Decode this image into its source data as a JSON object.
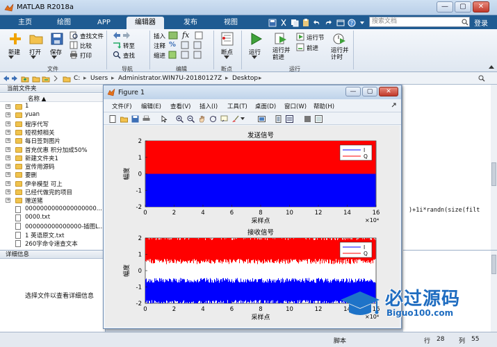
{
  "app": {
    "title": "MATLAB R2018a",
    "min": "—",
    "max": "▢",
    "close": "✕"
  },
  "tabs": [
    {
      "label": "主页"
    },
    {
      "label": "绘图"
    },
    {
      "label": "APP"
    },
    {
      "label": "编辑器"
    },
    {
      "label": "发布"
    },
    {
      "label": "视图"
    }
  ],
  "search": {
    "placeholder": "搜索文档"
  },
  "login": "登录",
  "ribbon": {
    "new": "新建",
    "open": "打开",
    "save": "保存",
    "find_files": "查找文件",
    "compare": "比较",
    "print": "打印",
    "goto": "转至",
    "find": "查找",
    "insert": "插入",
    "comment": "注释",
    "indent": "缩进",
    "breakpoint": "断点",
    "run": "运行",
    "run_advance": "运行并\n前进",
    "run_section": "运行节",
    "advance": "前进",
    "run_time": "运行并\n计时",
    "groups": {
      "file": "文件",
      "nav": "导航",
      "edit": "编辑",
      "breakpoints": "断点",
      "run": "运行"
    }
  },
  "address": {
    "path": [
      "C:",
      "Users",
      "Administrator.WIN7U-20180127Z",
      "Desktop"
    ]
  },
  "current_folder": {
    "title": "当前文件夹",
    "col_name": "名称 ▲",
    "items": [
      {
        "name": "1",
        "type": "folder"
      },
      {
        "name": "yuan",
        "type": "folder"
      },
      {
        "name": "程序代写",
        "type": "folder"
      },
      {
        "name": "短视频相关",
        "type": "folder"
      },
      {
        "name": "每日签到图片",
        "type": "folder"
      },
      {
        "name": "首充优惠 积分加成50%",
        "type": "folder"
      },
      {
        "name": "新建文件夹1",
        "type": "folder"
      },
      {
        "name": "宣传用源码",
        "type": "folder"
      },
      {
        "name": "要删",
        "type": "folder"
      },
      {
        "name": "伊辛模型 可上",
        "type": "folder"
      },
      {
        "name": "已经代做完的项目",
        "type": "folder"
      },
      {
        "name": "赠送猪",
        "type": "folder"
      },
      {
        "name": "0000000000000000000...",
        "type": "file"
      },
      {
        "name": "0000.txt",
        "type": "file"
      },
      {
        "name": "000000000000000-插图L...",
        "type": "file"
      },
      {
        "name": "1 英语原文.txt",
        "type": "file"
      },
      {
        "name": "260字命令速查文本",
        "type": "file"
      }
    ]
  },
  "details": {
    "title": "详细信息",
    "hint": "选择文件以查看详细信息"
  },
  "editor": {
    "code_fragment": ")+1i*randn(size(filt"
  },
  "status": {
    "script": "脚本",
    "row_label": "行",
    "row": "28",
    "col_label": "列",
    "col": "55"
  },
  "figure": {
    "title": "Figure 1",
    "menus": [
      "文件(F)",
      "编辑(E)",
      "查看(V)",
      "插入(I)",
      "工具(T)",
      "桌面(D)",
      "窗口(W)",
      "帮助(H)"
    ]
  },
  "chart_data": [
    {
      "type": "line",
      "title": "发送信号",
      "xlabel": "采样点",
      "ylabel": "幅度",
      "xlim": [
        0,
        160000
      ],
      "ylim": [
        -2,
        2
      ],
      "xticks": [
        "0",
        "2",
        "4",
        "6",
        "8",
        "10",
        "12",
        "14",
        "16"
      ],
      "xtick_values": [
        0,
        20000,
        40000,
        60000,
        80000,
        100000,
        120000,
        140000,
        160000
      ],
      "yticks": [
        "2",
        "1",
        "0",
        "-1",
        "-2"
      ],
      "ytick_values": [
        2,
        1,
        0,
        -1,
        -2
      ],
      "x_multiplier": "×10⁴",
      "legend": [
        "I",
        "Q"
      ],
      "legend_position": "top-right",
      "series": [
        {
          "name": "I",
          "color": "#0000ff",
          "band": [
            -2,
            0
          ]
        },
        {
          "name": "Q",
          "color": "#ff0000",
          "band": [
            0,
            2
          ]
        }
      ]
    },
    {
      "type": "line",
      "title": "接收信号",
      "xlabel": "采样点",
      "ylabel": "幅度",
      "xlim": [
        0,
        160000
      ],
      "ylim": [
        -2,
        2
      ],
      "xticks": [
        "0",
        "2",
        "4",
        "6",
        "8",
        "10",
        "12",
        "14",
        "16"
      ],
      "xtick_values": [
        0,
        20000,
        40000,
        60000,
        80000,
        100000,
        120000,
        140000,
        160000
      ],
      "yticks": [
        "2",
        "1",
        "0",
        "-1",
        "-2"
      ],
      "ytick_values": [
        2,
        1,
        0,
        -1,
        -2
      ],
      "x_multiplier": "×10⁴",
      "legend": [
        "I",
        "Q"
      ],
      "legend_position": "top-right",
      "series": [
        {
          "name": "I",
          "color": "#0000ff",
          "band": [
            -2.1,
            -0.45
          ]
        },
        {
          "name": "Q",
          "color": "#ff0000",
          "band": [
            0.4,
            2.2
          ]
        }
      ]
    }
  ],
  "watermark": {
    "brand": "必过源码",
    "url": "Biguo100.com"
  }
}
